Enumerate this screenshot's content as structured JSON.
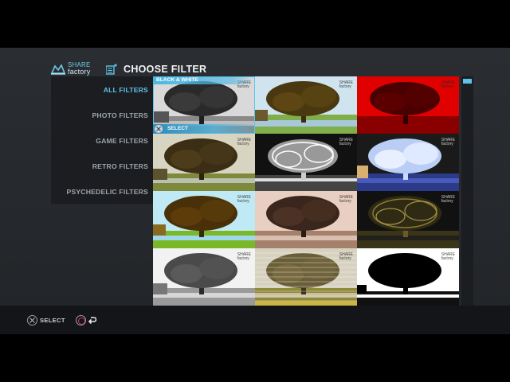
{
  "app": {
    "logo_line1": "SHARE",
    "logo_line2": "factory"
  },
  "header": {
    "title": "CHOOSE FILTER",
    "icon": "filter-list-icon"
  },
  "sidebar": {
    "items": [
      {
        "label": "ALL FILTERS",
        "active": true
      },
      {
        "label": "PHOTO FILTERS",
        "active": false
      },
      {
        "label": "GAME FILTERS",
        "active": false
      },
      {
        "label": "RETRO FILTERS",
        "active": false
      },
      {
        "label": "PSYCHEDELIC FILTERS",
        "active": false
      }
    ]
  },
  "grid": {
    "selected_name": "BLACK & WHITE",
    "selected_action": "SELECT",
    "tile_watermark_line1": "SHARE",
    "tile_watermark_line2": "factory"
  },
  "footer": {
    "select_label": "SELECT",
    "select_icon": "cross-button-icon",
    "back_icon": "circle-button-icon"
  },
  "colors": {
    "accent": "#5ec3ea",
    "background": "#2a2d31",
    "panel": "#1b1d20",
    "footer": "#141518"
  }
}
